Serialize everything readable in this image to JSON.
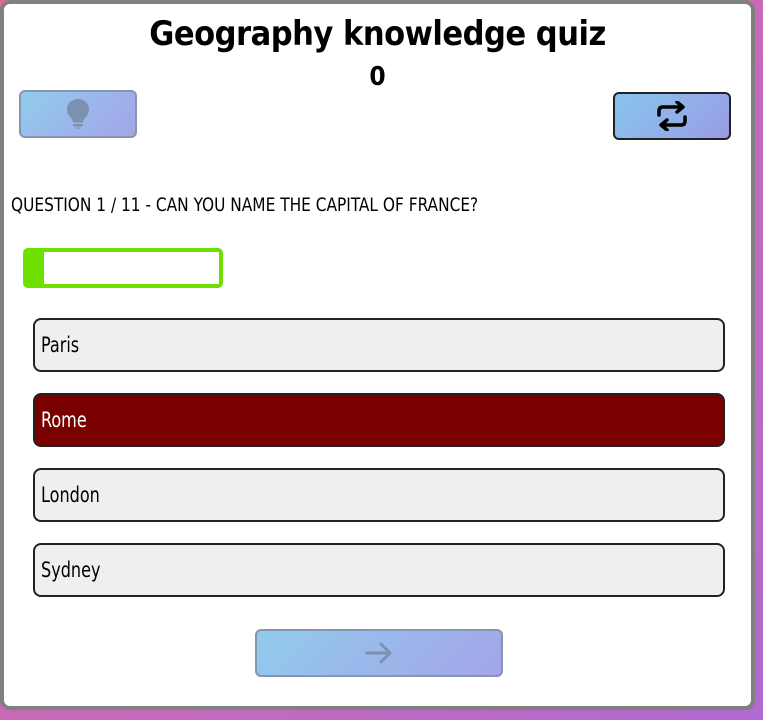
{
  "header": {
    "title": "Geography knowledge quiz",
    "score": "0"
  },
  "buttons": {
    "hint_icon": "lightbulb-icon",
    "repeat_icon": "repeat-icon",
    "next_icon": "arrow-right-icon"
  },
  "question": {
    "text": "QUESTION 1 / 11 - CAN YOU NAME THE CAPITAL OF FRANCE?",
    "progress": 0.09
  },
  "answers": [
    {
      "label": "Paris",
      "state": "default"
    },
    {
      "label": "Rome",
      "state": "wrong"
    },
    {
      "label": "London",
      "state": "default"
    },
    {
      "label": "Sydney",
      "state": "default"
    }
  ],
  "colors": {
    "progress": "#6ee000",
    "wrong_answer": "#7a0000",
    "button_gradient_start": "#86c6ec",
    "button_gradient_end": "#9b9be6"
  }
}
